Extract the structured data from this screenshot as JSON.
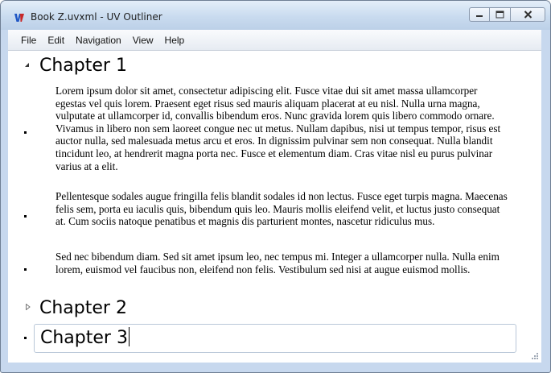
{
  "window": {
    "title": "Book Z.uvxml - UV Outliner",
    "icon": "app-icon",
    "controls": [
      "minimize-icon",
      "maximize-icon",
      "close-icon"
    ]
  },
  "menu": [
    "File",
    "Edit",
    "Navigation",
    "View",
    "Help"
  ],
  "outline": {
    "chapter1": {
      "title": "Chapter 1",
      "expanded": true,
      "paragraphs": [
        "Lorem ipsum dolor sit amet, consectetur adipiscing elit. Fusce vitae dui sit amet massa ullamcorper egestas vel quis lorem. Praesent eget risus sed mauris aliquam placerat at eu nisl. Nulla urna magna, vulputate at ullamcorper id, convallis bibendum eros. Nunc gravida lorem quis libero commodo ornare. Vivamus in libero non sem laoreet congue nec ut metus. Nullam dapibus, nisi ut tempus tempor, risus est auctor nulla, sed malesuada metus arcu et eros. In dignissim pulvinar sem non consequat. Nulla blandit tincidunt leo, at hendrerit magna porta nec. Fusce et elementum diam. Cras vitae nisl eu purus pulvinar varius at a elit.",
        "Pellentesque sodales augue fringilla felis blandit sodales id non lectus. Fusce eget turpis magna. Maecenas felis sem, porta eu iaculis quis, bibendum quis leo. Mauris mollis eleifend velit, et luctus justo consequat at. Cum sociis natoque penatibus et magnis dis parturient montes, nascetur ridiculus mus.",
        "Sed nec bibendum diam. Sed sit amet ipsum leo, nec tempus mi. Integer a ullamcorper nulla. Nulla enim lorem, euismod vel faucibus non, eleifend non felis. Vestibulum sed nisi at augue euismod mollis."
      ]
    },
    "chapter2": {
      "title": "Chapter 2",
      "expanded": false
    },
    "chapter3": {
      "title": "Chapter 3",
      "editing": true
    }
  }
}
